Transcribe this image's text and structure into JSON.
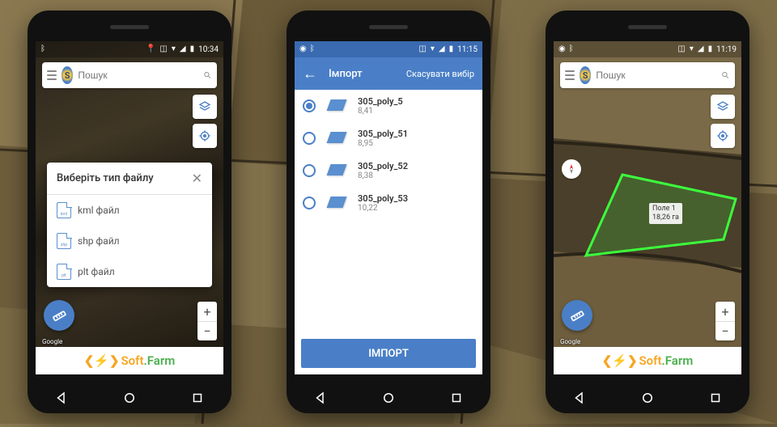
{
  "phone1": {
    "time": "10:34",
    "search_placeholder": "Пошук",
    "dialog_title": "Виберіть тип файлу",
    "files": [
      {
        "ext": "kml",
        "label": "kml файл"
      },
      {
        "ext": "shp",
        "label": "shp файл"
      },
      {
        "ext": "plt",
        "label": "plt файл"
      }
    ],
    "attribution": "Google",
    "brand_soft": "Soft",
    "brand_farm": ".Farm"
  },
  "phone2": {
    "time": "11:15",
    "appbar_title": "Імпорт",
    "appbar_action": "Скасувати вибір",
    "rows": [
      {
        "name": "305_poly_5",
        "size": "8,41",
        "selected": true
      },
      {
        "name": "305_poly_51",
        "size": "8,95",
        "selected": false
      },
      {
        "name": "305_poly_52",
        "size": "8,38",
        "selected": false
      },
      {
        "name": "305_poly_53",
        "size": "10,22",
        "selected": false
      }
    ],
    "import_button": "ІМПОРТ"
  },
  "phone3": {
    "time": "11:19",
    "search_placeholder": "Пошук",
    "field_name": "Поле 1",
    "field_area": "18,26 га",
    "attribution": "Google",
    "brand_soft": "Soft",
    "brand_farm": ".Farm"
  }
}
